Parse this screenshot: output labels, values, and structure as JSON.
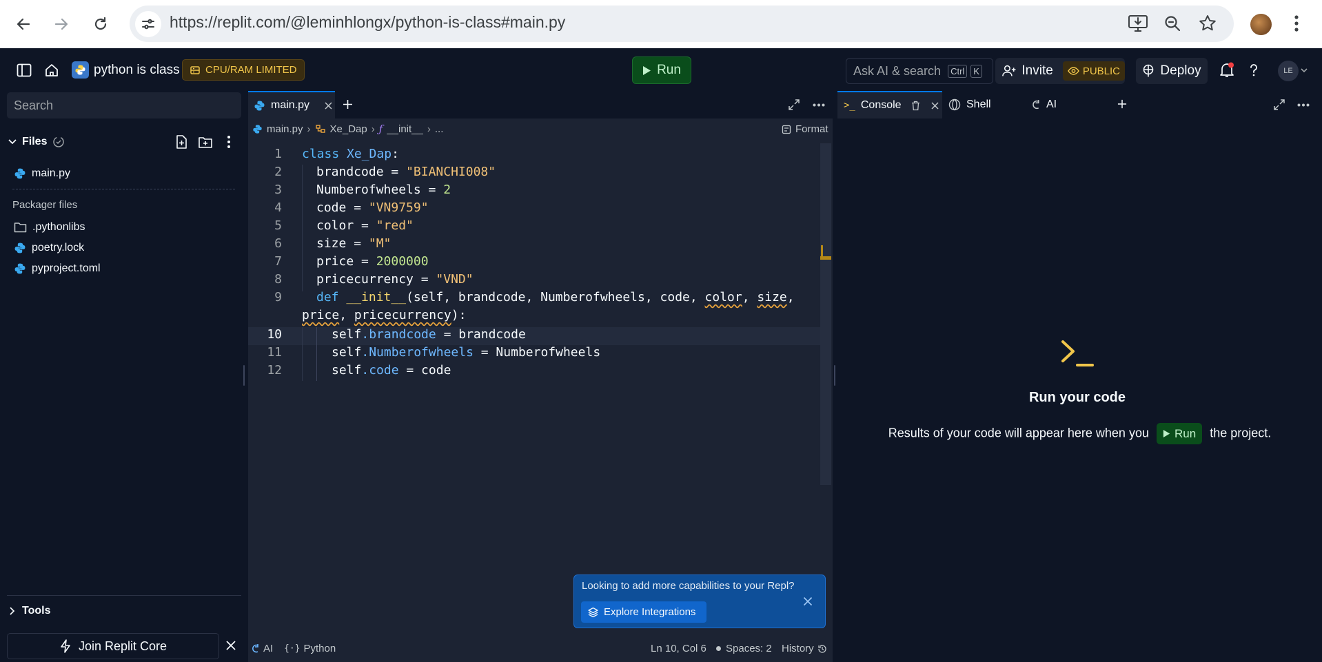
{
  "browser": {
    "url": "https://replit.com/@leminhlongx/python-is-class#main.py"
  },
  "topbar": {
    "repl_name": "python is class",
    "resource_badge": "CPU/RAM LIMITED",
    "run_label": "Run",
    "ask_ai_placeholder": "Ask AI & search",
    "shortcut_ctrl": "Ctrl",
    "shortcut_key": "K",
    "invite_label": "Invite",
    "visibility_label": "PUBLIC",
    "deploy_label": "Deploy",
    "user_initials": "LE"
  },
  "sidebar": {
    "search_placeholder": "Search",
    "files_header": "Files",
    "files": [
      {
        "name": "main.py",
        "icon": "python-icon"
      }
    ],
    "packager_header": "Packager files",
    "packager_files": [
      {
        "name": ".pythonlibs",
        "icon": "folder-icon"
      },
      {
        "name": "poetry.lock",
        "icon": "python-icon"
      },
      {
        "name": "pyproject.toml",
        "icon": "python-icon"
      }
    ],
    "tools_label": "Tools",
    "join_core_label": "Join Replit Core"
  },
  "editor": {
    "tab_label": "main.py",
    "breadcrumb": {
      "file": "main.py",
      "class": "Xe_Dap",
      "function": "__init__",
      "ellipsis": "..."
    },
    "format_label": "Format",
    "line_numbers": [
      "1",
      "2",
      "3",
      "4",
      "5",
      "6",
      "7",
      "8",
      "9",
      "10",
      "11",
      "12"
    ],
    "active_line": "10",
    "code": {
      "l1_kw": "class",
      "l1_name": "Xe_Dap",
      "l1_colon": ":",
      "l2_name": "brandcode",
      "l2_val": "\"BIANCHI008\"",
      "l3_name": "Numberofwheels",
      "l3_val": "2",
      "l4_name": "code",
      "l4_val": "\"VN9759\"",
      "l5_name": "color",
      "l5_val": "\"red\"",
      "l6_name": "size",
      "l6_val": "\"M\"",
      "l7_name": "price",
      "l7_val": "2000000",
      "l8_name": "pricecurrency",
      "l8_val": "\"VND\"",
      "l9_kw": "def",
      "l9_fn": "__init__",
      "l9_params_a": "(self, brandcode, Numberofwheels, code, ",
      "l9_p_color": "color",
      "l9_sep1": ", ",
      "l9_p_size": "size",
      "l9_sep2": ",",
      "l9w_price": "price",
      "l9w_sep": ", ",
      "l9w_pc": "pricecurrency",
      "l9w_end": "):",
      "l10_self": "self",
      "l10_attr": ".brandcode",
      "l10_rhs": " = brandcode",
      "l11_self": "self",
      "l11_attr": ".Numberofwheels",
      "l11_rhs": " = Numberofwheels",
      "l12_self": "self",
      "l12_attr": ".code",
      "l12_rhs": " = code"
    },
    "integration_popup": {
      "text": "Looking to add more capabilities to your Repl?",
      "button_label": "Explore Integrations"
    },
    "status": {
      "ai": "AI",
      "language": "Python",
      "cursor": "Ln 10, Col 6",
      "spaces": "Spaces: 2",
      "history": "History"
    }
  },
  "console": {
    "tabs": [
      "Console",
      "Shell",
      "AI"
    ],
    "heading": "Run your code",
    "text_before": "Results of your code will appear here when you",
    "run_label": "Run",
    "text_after": "the project."
  },
  "colors": {
    "bg": "#0e1525",
    "panel": "#1c2333",
    "run_green": "#0a4d1b",
    "accent_blue": "#0079f2",
    "badge_yellow": "#f0c54a"
  }
}
